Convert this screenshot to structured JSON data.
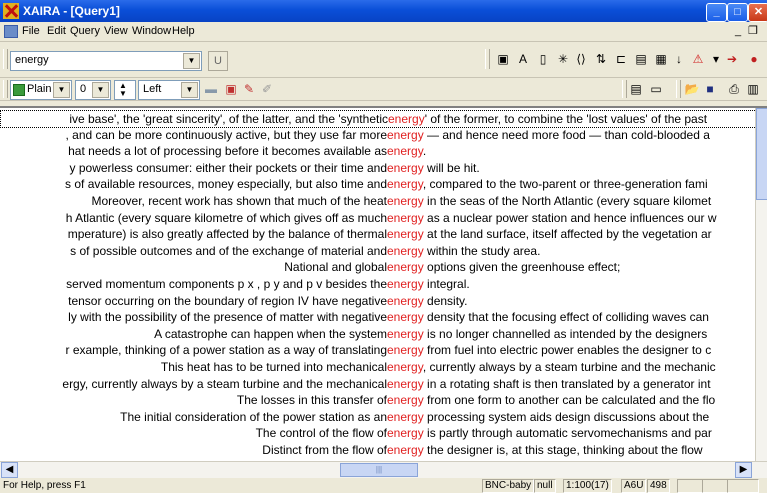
{
  "window": {
    "title": "XAIRA - [Query1]"
  },
  "menu": [
    "File",
    "Edit",
    "Query",
    "View",
    "Window",
    "Help"
  ],
  "toolbar1": {
    "query_value": "energy",
    "u_button": "U",
    "icons": [
      "bookmark-icon",
      "font-icon",
      "text-icon",
      "asterisk-icon",
      "code-icon",
      "sort-icon",
      "collocation-icon",
      "thesaurus-icon",
      "grid-icon",
      "sort-az-icon",
      "warning-icon",
      "export-icon"
    ]
  },
  "toolbar2": {
    "view_value": "Plain",
    "context_value": "0",
    "align_value": "Left"
  },
  "concordance": [
    {
      "left": "ive base', the 'great sincerity', of the latter, and the 'synthetic ",
      "kw": "energy",
      "right": "' of the former, to combine the 'lost values' of the past"
    },
    {
      "left": ", and can be more continuously active, but they use far more ",
      "kw": "energy",
      "right": " — and hence need more food — than cold-blooded a"
    },
    {
      "left": "hat needs a lot of processing before it becomes available as ",
      "kw": "energy",
      "right": "."
    },
    {
      "left": "y powerless consumer: either their pockets or their time and ",
      "kw": "energy",
      "right": " will be hit."
    },
    {
      "left": "s of available resources, money especially, but also time and ",
      "kw": "energy",
      "right": ", compared to the two-parent or three-generation fami"
    },
    {
      "left": "Moreover, recent work has shown that much of the heat ",
      "kw": "energy",
      "right": " in the seas of the North Atlantic (every square kilomet"
    },
    {
      "left": "h Atlantic (every square kilometre of which gives off as much ",
      "kw": "energy",
      "right": " as a nuclear power station and hence influences our w"
    },
    {
      "left": "mperature) is also greatly affected by the balance of thermal ",
      "kw": "energy",
      "right": " at the land surface, itself affected by the vegetation ar"
    },
    {
      "left": "s of possible outcomes and of the exchange of material and ",
      "kw": "energy",
      "right": " within the study area."
    },
    {
      "left": "National and global ",
      "kw": "energy",
      "right": " options given the greenhouse effect;"
    },
    {
      "left": "served momentum components p x , p y and p v besides the ",
      "kw": "energy",
      "right": " integral."
    },
    {
      "left": "tensor occurring on the boundary of region IV have negative ",
      "kw": "energy",
      "right": " density."
    },
    {
      "left": "ly with the possibility of the presence of matter with negative ",
      "kw": "energy",
      "right": " density that the focusing effect of colliding waves can"
    },
    {
      "left": "A catastrophe can happen when the system ",
      "kw": "energy",
      "right": " is no longer channelled as intended by the designers"
    },
    {
      "left": "r example, thinking of a power station as a way of translating ",
      "kw": "energy",
      "right": " from fuel into electric power enables the designer to c"
    },
    {
      "left": "This heat has to be turned into mechanical ",
      "kw": "energy",
      "right": ", currently always by a steam turbine and the mechanic"
    },
    {
      "left": "ergy, currently always by a steam turbine and the mechanical ",
      "kw": "energy",
      "right": " in a rotating shaft is then translated by a generator int"
    },
    {
      "left": "The losses in this transfer of ",
      "kw": "energy",
      "right": " from one form to another can be calculated and the flo"
    },
    {
      "left": "The initial consideration of the power station as an ",
      "kw": "energy",
      "right": " processing system aids design discussions about the"
    },
    {
      "left": "The control of the flow of ",
      "kw": "energy",
      "right": " is partly through automatic servomechanisms and par"
    },
    {
      "left": "Distinct from the flow of ",
      "kw": "energy",
      "right": " the designer is, at this stage, thinking about the flow"
    }
  ],
  "status": {
    "help": "For Help, press F1",
    "corpus": "BNC-baby",
    "filter": "null",
    "ratio": "1:100(17)",
    "code": "A6U",
    "count": "498"
  }
}
